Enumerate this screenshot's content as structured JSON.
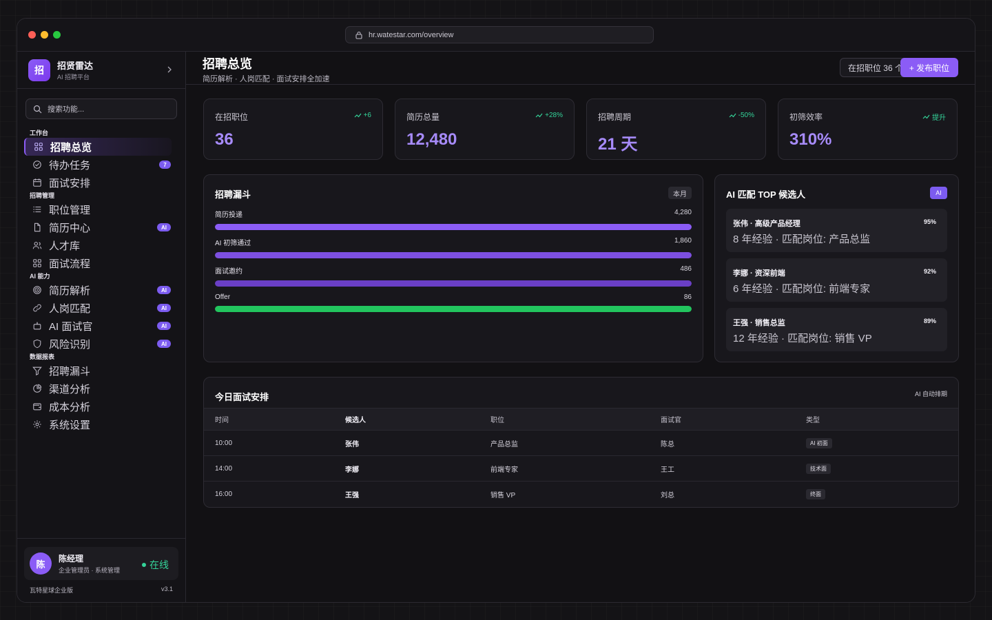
{
  "browser": {
    "url": "hr.watestar.com/overview"
  },
  "brand": {
    "logo": "招",
    "name": "招贤雷达",
    "subtitle": "AI 招聘平台"
  },
  "search": {
    "placeholder": "搜索功能..."
  },
  "sidebar": {
    "sections": [
      {
        "title": "工作台",
        "items": [
          {
            "label": "招聘总览",
            "icon": "grid-icon",
            "active": true
          },
          {
            "label": "待办任务",
            "icon": "check-circle-icon",
            "badge": "7"
          },
          {
            "label": "面试安排",
            "icon": "calendar-icon"
          }
        ]
      },
      {
        "title": "招聘管理",
        "items": [
          {
            "label": "职位管理",
            "icon": "list-icon"
          },
          {
            "label": "简历中心",
            "icon": "file-icon",
            "badge": "AI"
          },
          {
            "label": "人才库",
            "icon": "users-icon"
          },
          {
            "label": "面试流程",
            "icon": "grid-icon"
          }
        ]
      },
      {
        "title": "AI 能力",
        "items": [
          {
            "label": "简历解析",
            "icon": "target-icon",
            "badge": "AI"
          },
          {
            "label": "人岗匹配",
            "icon": "link-icon",
            "badge": "AI"
          },
          {
            "label": "AI 面试官",
            "icon": "robot-icon",
            "badge": "AI"
          },
          {
            "label": "风险识别",
            "icon": "shield-icon",
            "badge": "AI"
          }
        ]
      },
      {
        "title": "数据报表",
        "items": [
          {
            "label": "招聘漏斗",
            "icon": "funnel-icon"
          },
          {
            "label": "渠道分析",
            "icon": "pie-icon"
          },
          {
            "label": "成本分析",
            "icon": "wallet-icon"
          },
          {
            "label": "系统设置",
            "icon": "gear-icon"
          }
        ]
      }
    ]
  },
  "user": {
    "avatar": "陈",
    "name": "陈经理",
    "role": "企业管理员 · 系统管理",
    "status": "在线"
  },
  "edition": {
    "name": "瓦特星球企业版",
    "version": "v3.1"
  },
  "header": {
    "title": "招聘总览",
    "subtitle": "简历解析 · 人岗匹配 · 面试安排全加速",
    "open_positions_button": "在招职位 36 个",
    "publish_button": "+ 发布职位"
  },
  "stats": [
    {
      "label": "在招职位",
      "value": "36",
      "trend": "+6"
    },
    {
      "label": "简历总量",
      "value": "12,480",
      "trend": "+28%"
    },
    {
      "label": "招聘周期",
      "value": "21 天",
      "trend": "-50%"
    },
    {
      "label": "初筛效率",
      "value": "310%",
      "trend": "提升"
    }
  ],
  "funnel": {
    "title": "招聘漏斗",
    "period": "本月",
    "stages": [
      {
        "label": "简历投递",
        "value": "4,280",
        "fill": 1.0,
        "color": "#8b5cf6"
      },
      {
        "label": "AI 初筛通过",
        "value": "1,860",
        "fill": 1.0,
        "color": "#7c4fe0"
      },
      {
        "label": "面试邀约",
        "value": "486",
        "fill": 1.0,
        "color": "#6a3fc6"
      },
      {
        "label": "Offer",
        "value": "86",
        "fill": 1.0,
        "color": "#22c55e"
      }
    ]
  },
  "top_candidates": {
    "title": "AI 匹配 TOP 候选人",
    "tag": "AI",
    "items": [
      {
        "name": "张伟 · 高级产品经理",
        "score": "95%",
        "desc": "8 年经验 · 匹配岗位: 产品总监"
      },
      {
        "name": "李娜 · 资深前端",
        "score": "92%",
        "desc": "6 年经验 · 匹配岗位: 前端专家"
      },
      {
        "name": "王强 · 销售总监",
        "score": "89%",
        "desc": "12 年经验 · 匹配岗位: 销售 VP"
      }
    ]
  },
  "schedule": {
    "title": "今日面试安排",
    "tag": "AI 自动排期",
    "columns": [
      "时间",
      "候选人",
      "职位",
      "面试官",
      "类型"
    ],
    "rows": [
      {
        "time": "10:00",
        "candidate": "张伟",
        "position": "产品总监",
        "interviewer": "陈总",
        "type": "AI 初面"
      },
      {
        "time": "14:00",
        "candidate": "李娜",
        "position": "前端专家",
        "interviewer": "王工",
        "type": "技术面"
      },
      {
        "time": "16:00",
        "candidate": "王强",
        "position": "销售 VP",
        "interviewer": "刘总",
        "type": "终面"
      }
    ]
  },
  "colors": {
    "accent": "#8b5cf6",
    "positive": "#34d399",
    "success_bar": "#22c55e"
  }
}
